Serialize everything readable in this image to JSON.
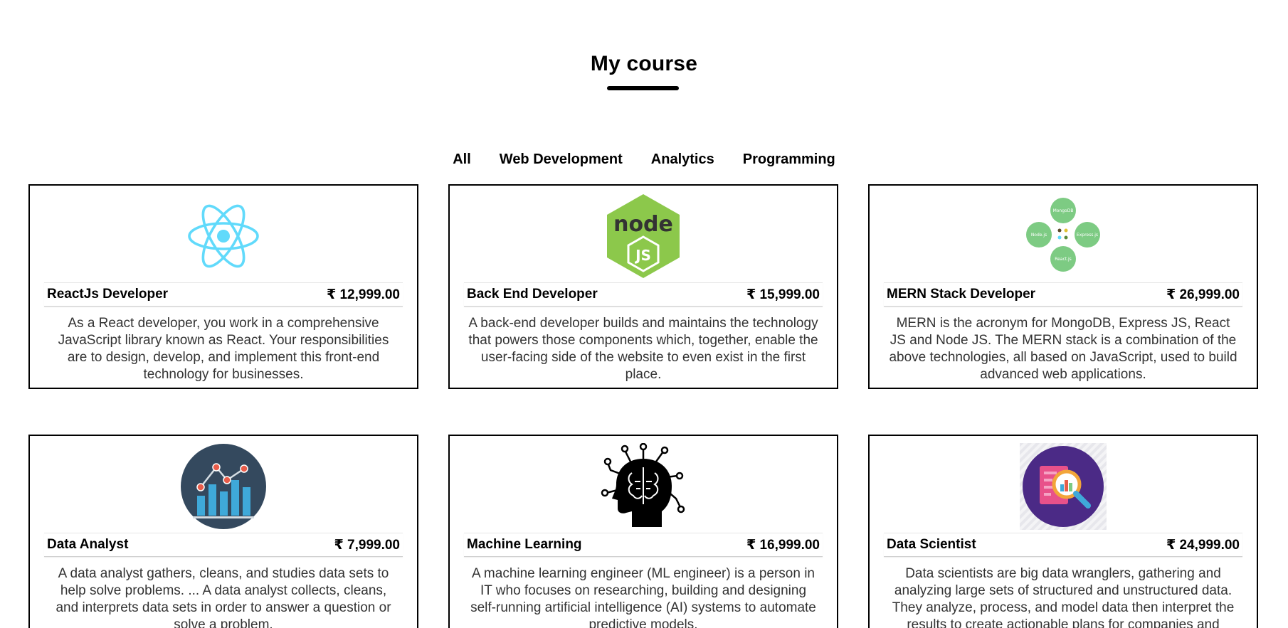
{
  "page": {
    "title": "My course"
  },
  "filters": [
    "All",
    "Web Development",
    "Analytics",
    "Programming"
  ],
  "courses": [
    {
      "icon": "react-logo-icon",
      "name": "ReactJs Developer",
      "price": "₹ 12,999.00",
      "description": "As a React developer, you work in a comprehensive JavaScript library known as React. Your responsibilities are to design, develop, and implement this front-end technology for businesses."
    },
    {
      "icon": "nodejs-logo-icon",
      "name": "Back End Developer",
      "price": "₹ 15,999.00",
      "description": "A back-end developer builds and maintains the technology that powers those components which, together, enable the user-facing side of the website to even exist in the first place."
    },
    {
      "icon": "mern-stack-icon",
      "name": "MERN Stack Developer",
      "price": "₹ 26,999.00",
      "description": "MERN is the acronym for MongoDB, Express JS, React JS and Node JS. The MERN stack is a combination of the above technologies, all based on JavaScript, used to build advanced web applications.",
      "diagram_labels": [
        "MongoDB",
        "Node.js",
        "Express.js",
        "React.js"
      ]
    },
    {
      "icon": "data-analyst-chart-icon",
      "name": "Data Analyst",
      "price": "₹ 7,999.00",
      "description": "A data analyst gathers, cleans, and studies data sets to help solve problems. ... A data analyst collects, cleans, and interprets data sets in order to answer a question or solve a problem."
    },
    {
      "icon": "ai-brain-head-icon",
      "name": "Machine Learning",
      "price": "₹ 16,999.00",
      "description": "A machine learning engineer (ML engineer) is a person in IT who focuses on researching, building and designing self-running artificial intelligence (AI) systems to automate predictive models."
    },
    {
      "icon": "data-scientist-magnifier-icon",
      "name": "Data Scientist",
      "price": "₹ 24,999.00",
      "description": "Data scientists are big data wranglers, gathering and analyzing large sets of structured and unstructured data. They analyze, process, and model data then interpret the results to create actionable plans for companies and organizations."
    }
  ],
  "colors": {
    "react": "#61DAFB",
    "node_green": "#8CC84B",
    "mern_green": "#7DCB83",
    "analyst_bg": "#34495E",
    "analyst_bar": "#3FA9D9",
    "analyst_point": "#E85C4A",
    "scientist_bg": "#4B2A86"
  }
}
